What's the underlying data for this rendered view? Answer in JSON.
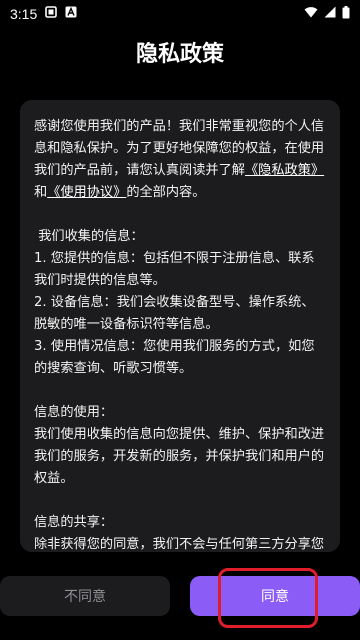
{
  "status_bar": {
    "time": "3:15",
    "icons": [
      "notification-box-icon",
      "text-a-icon",
      "wifi-icon",
      "signal-icon",
      "battery-icon"
    ]
  },
  "page": {
    "title": "隐私政策"
  },
  "policy": {
    "intro_part1": "感谢您使用我们的产品！我们非常重视您的个人信息和隐私保护。为了更好地保障您的权益，在使用我们的产品前，请您认真阅读并了解",
    "privacy_link": "《隐私政策》",
    "and_text": "和",
    "terms_link": "《使用协议》",
    "intro_part2": "的全部内容。",
    "section1_title": " 我们收集的信息：",
    "section1_item1": "1. 您提供的信息：包括但不限于注册信息、联系我们时提供的信息等。",
    "section1_item2": "2. 设备信息：我们会收集设备型号、操作系统、脱敏的唯一设备标识符等信息。",
    "section1_item3": "3. 使用情况信息：您使用我们服务的方式，如您的搜索查询、听歌习惯等。",
    "section2_title": "信息的使用：",
    "section2_body": "我们使用收集的信息向您提供、维护、保护和改进我们的服务，开发新的服务，并保护我们和用户的权益。",
    "section3_title": "信息的共享：",
    "section3_body": "除非获得您的同意，我们不会与任何第三方分享您的个人信息。"
  },
  "buttons": {
    "disagree": "不同意",
    "agree": "同意"
  },
  "colors": {
    "background": "#000000",
    "card": "#1c1c1e",
    "accent": "#8b5cf6",
    "highlight": "#e01d2a"
  }
}
